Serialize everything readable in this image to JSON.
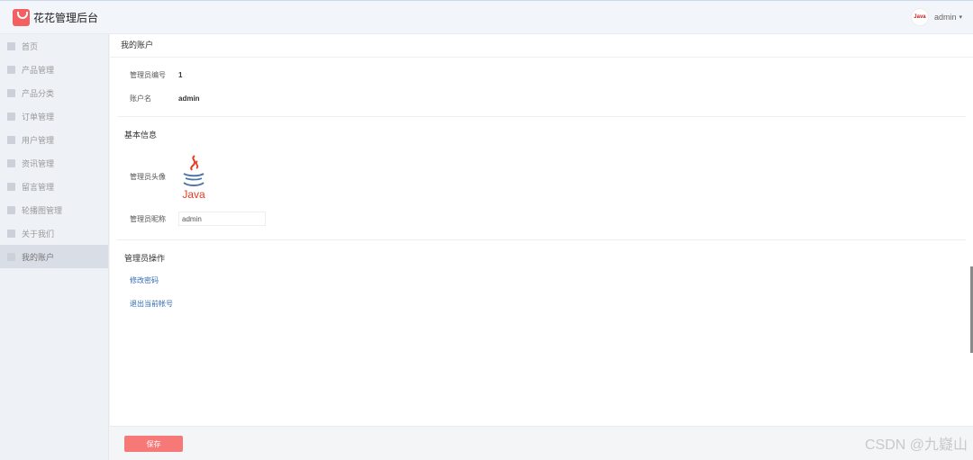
{
  "app": {
    "title": "花花管理后台",
    "brand_color": "#f45f61"
  },
  "header": {
    "username": "admin",
    "caret": "▾",
    "avatar_text": "Java"
  },
  "sidebar": {
    "items": [
      {
        "label": "首页",
        "icon": "home-icon"
      },
      {
        "label": "产品管理",
        "icon": "image-icon"
      },
      {
        "label": "产品分类",
        "icon": "grid-icon"
      },
      {
        "label": "订单管理",
        "icon": "clipboard-icon"
      },
      {
        "label": "用户管理",
        "icon": "user-icon"
      },
      {
        "label": "资讯管理",
        "icon": "grid-icon"
      },
      {
        "label": "留言管理",
        "icon": "grid-icon"
      },
      {
        "label": "轮播图管理",
        "icon": "gear-icon"
      },
      {
        "label": "关于我们",
        "icon": "grid-icon"
      },
      {
        "label": "我的账户",
        "icon": "gear-icon",
        "active": true
      }
    ]
  },
  "account": {
    "page_title": "我的账户",
    "admin_id_label": "管理员编号",
    "admin_id": "1",
    "account_name_label": "账户名",
    "account_name": "admin",
    "basic_info_title": "基本信息",
    "avatar_label": "管理员头像",
    "avatar_text": "Java",
    "nickname_label": "管理员昵称",
    "nickname": "admin",
    "operations_title": "管理员操作",
    "change_password": "修改密码",
    "logout": "退出当前帐号"
  },
  "footer": {
    "save_label": "保存",
    "watermark": "CSDN @九嶷山",
    "button_color": "#f67978"
  }
}
